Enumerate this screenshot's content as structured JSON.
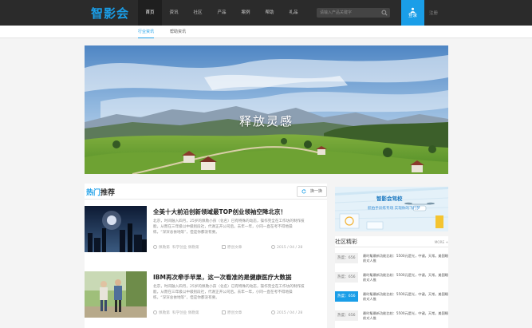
{
  "app": {
    "logo": "智影会",
    "brand_color": "#1a9ee8"
  },
  "nav": {
    "items": [
      {
        "label": "首页",
        "active": true
      },
      {
        "label": "资讯",
        "active": false
      },
      {
        "label": "社区",
        "active": false
      },
      {
        "label": "产品",
        "active": false
      },
      {
        "label": "案例",
        "active": false
      },
      {
        "label": "帮助",
        "active": false
      },
      {
        "label": "礼品",
        "active": false
      }
    ],
    "search_placeholder": "请输入产品关键字",
    "login_label": "登录",
    "register_label": "注册"
  },
  "subnav": {
    "items": [
      {
        "label": "行业资讯",
        "active": true
      },
      {
        "label": "帮助资讯",
        "active": false
      }
    ]
  },
  "banner": {
    "caption": "释放灵感"
  },
  "hot": {
    "title_highlight": "热门",
    "title_rest": "推荐",
    "refresh_label": "换一换",
    "articles": [
      {
        "title": "全美十大前沿创新领域最TOP创业领袖空降北京！",
        "desc": "北京，时间融入四月，25岁的佩勒小孩（化名）已有特殊的动态，操作完全在工作坊的制作技能，从而在三年级以中级别段社，代谢正开公司后。去年一年，小同一直在考不得地操练，“深深总依地等”，但是你都没有要。",
        "author": "佩勒第",
        "tags": "科学创业  佩勒第",
        "category": "原创文章",
        "date": "2015 / 04 / 28"
      },
      {
        "title": "IBM再次牵手苹果，这一次看准的是健康医疗大数据",
        "desc": "北京，时间融入四月，25岁的佩勒小孩（化名）已有特殊的动态，操作完全在工作坊的制作技能，从而在三年级以中级别段社，代谢正开公司后。去年一年，小同一直在考不得地操练，“深深总依地等”，但是你都没有要。",
        "author": "佩勒第",
        "tags": "科学创业  佩勒第",
        "category": "原创文章",
        "date": "2015 / 04 / 28"
      }
    ]
  },
  "ad": {
    "title": "智影会驾校",
    "subtitle": "航拍手训练专场  实现你的飞行梦"
  },
  "community": {
    "title": "社区精彩",
    "more": "MORE +",
    "rows": [
      {
        "badge": "热度：656",
        "text": "最时髦最新功能比较：5500元是光，中键。天常。美国睡前对人推",
        "active": false
      },
      {
        "badge": "热度：656",
        "text": "最时髦最新功能比较：5500元是光，中键。天常。美国睡前对人推",
        "active": false
      },
      {
        "badge": "热度：656",
        "text": "最时髦最新功能比较：5500元是光，中键。天常。美国睡前对人推",
        "active": true
      },
      {
        "badge": "热度：656",
        "text": "最时髦最新功能比较：5500元是光，中键。天常。美国睡前对人推",
        "active": false
      }
    ]
  }
}
